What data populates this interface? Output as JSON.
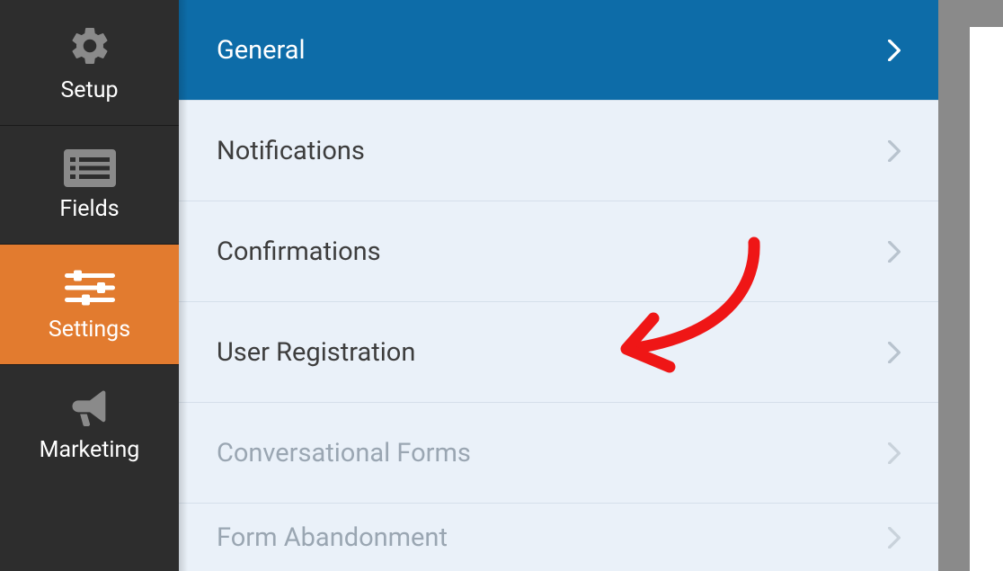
{
  "sidebar": {
    "items": [
      {
        "label": "Setup",
        "active": false
      },
      {
        "label": "Fields",
        "active": false
      },
      {
        "label": "Settings",
        "active": true
      },
      {
        "label": "Marketing",
        "active": false
      }
    ]
  },
  "settings": {
    "items": [
      {
        "label": "General",
        "selected": true,
        "disabled": false
      },
      {
        "label": "Notifications",
        "selected": false,
        "disabled": false
      },
      {
        "label": "Confirmations",
        "selected": false,
        "disabled": false
      },
      {
        "label": "User Registration",
        "selected": false,
        "disabled": false
      },
      {
        "label": "Conversational Forms",
        "selected": false,
        "disabled": true
      },
      {
        "label": "Form Abandonment",
        "selected": false,
        "disabled": true
      }
    ]
  },
  "colors": {
    "sidebar_bg": "#2d2d2d",
    "sidebar_active": "#e27b2f",
    "panel_bg": "#eaf1f9",
    "selected_bg": "#0d6ca8",
    "annotation": "#ef1616"
  }
}
